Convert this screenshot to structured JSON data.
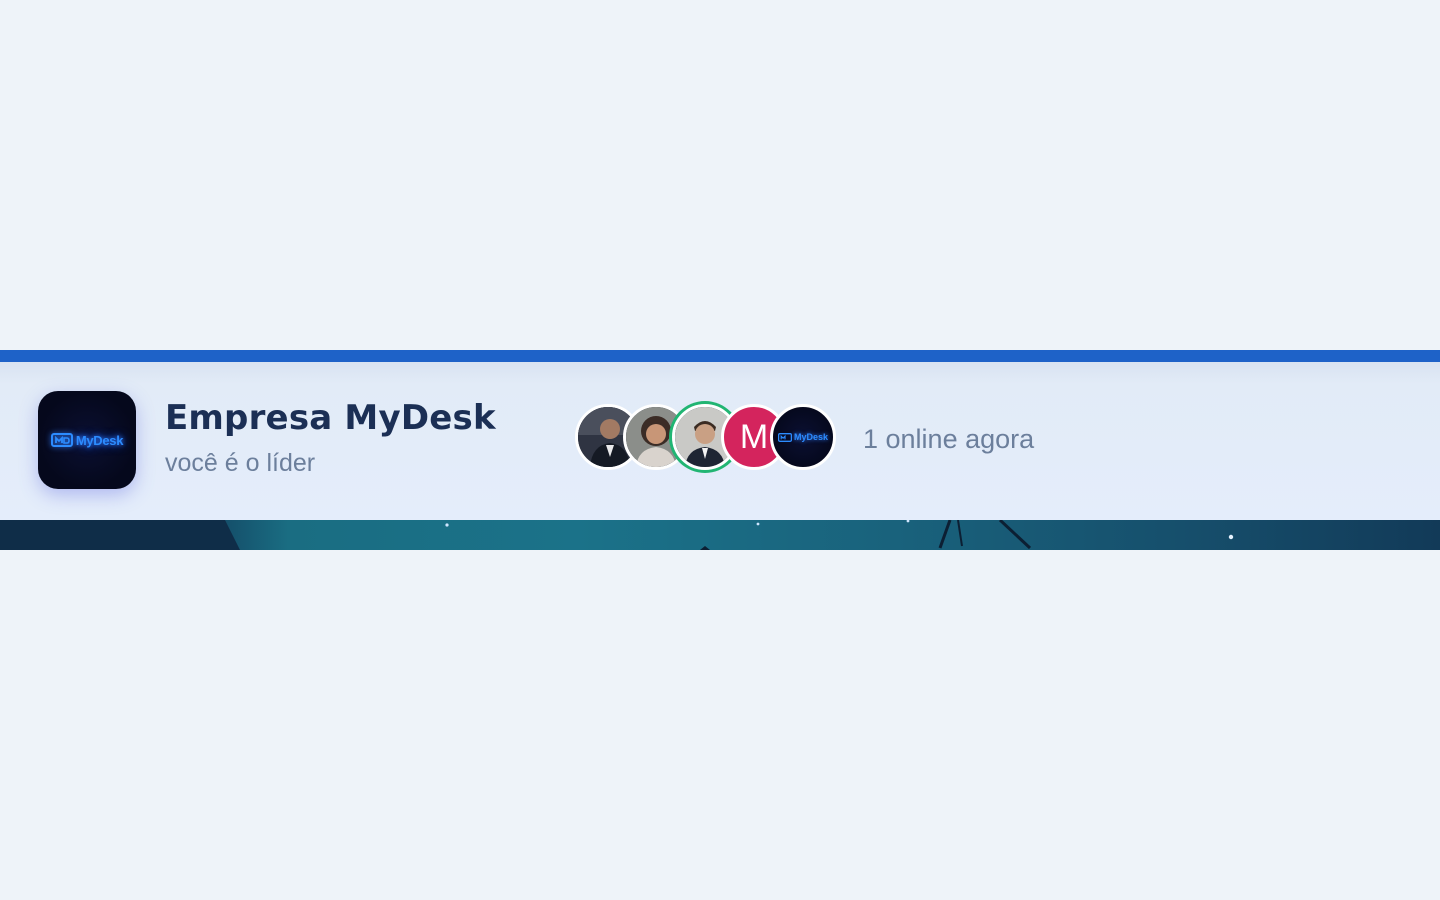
{
  "team": {
    "name": "Empresa MyDesk",
    "role_text": "você é o líder",
    "logo": {
      "icon": "mydesk-logo-icon",
      "text": "MyDesk"
    }
  },
  "members": [
    {
      "type": "photo",
      "icon": "member-photo-1-icon",
      "online": false
    },
    {
      "type": "photo",
      "icon": "member-photo-2-icon",
      "online": false
    },
    {
      "type": "photo",
      "icon": "member-photo-3-icon",
      "online": true
    },
    {
      "type": "initial",
      "initial": "M",
      "color": "#d4245d",
      "online": false
    },
    {
      "type": "logo",
      "text": "MyDesk",
      "online": false
    }
  ],
  "online_status": "1 online agora",
  "colors": {
    "accent": "#1e62c8",
    "title": "#1b2f55",
    "muted": "#6c7f9c",
    "online_ring": "#21b573",
    "logo_glow": "#2c8cff"
  }
}
